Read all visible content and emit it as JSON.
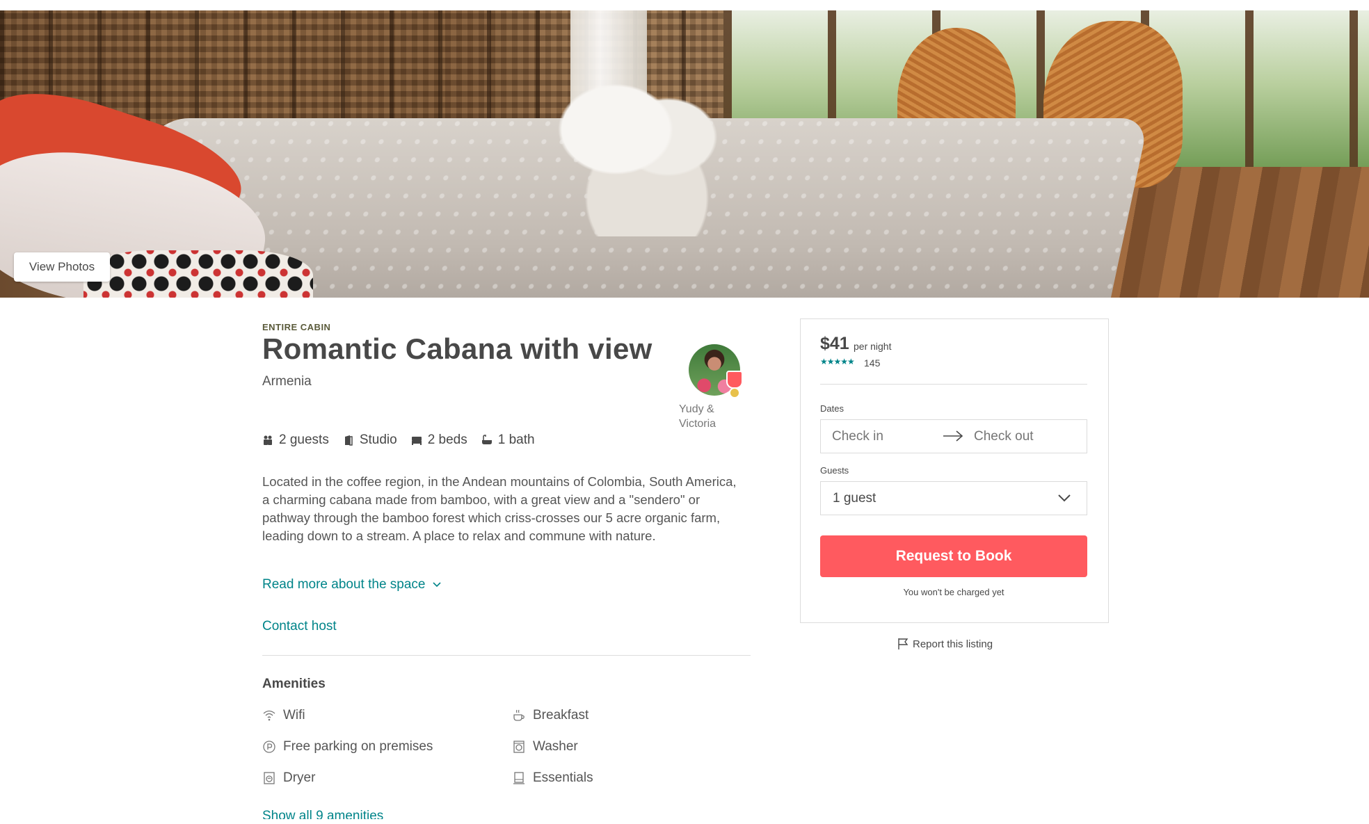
{
  "hero": {
    "view_photos_label": "View Photos"
  },
  "listing": {
    "kind": "ENTIRE CABIN",
    "title": "Romantic Cabana with view",
    "location": "Armenia",
    "host_name": "Yudy & Victoria",
    "facts": {
      "guests": "2 guests",
      "room": "Studio",
      "beds": "2 beds",
      "baths": "1 bath"
    },
    "description": "Located in the coffee region, in the Andean mountains of Colombia, South America, a charming cabana made from bamboo, with a great view and a \"sendero\" or pathway through the bamboo forest which criss-crosses our 5 acre organic farm, leading down to a stream. A place to relax and commune with nature.",
    "read_more_label": "Read more about the space",
    "contact_host_label": "Contact host"
  },
  "amenities": {
    "heading": "Amenities",
    "items": [
      {
        "label": "Wifi",
        "icon": "wifi-icon"
      },
      {
        "label": "Breakfast",
        "icon": "coffee-cup-icon"
      },
      {
        "label": "Free parking on premises",
        "icon": "parking-icon"
      },
      {
        "label": "Washer",
        "icon": "washer-icon"
      },
      {
        "label": "Dryer",
        "icon": "dryer-icon"
      },
      {
        "label": "Essentials",
        "icon": "essentials-icon"
      }
    ],
    "show_all_label": "Show all 9 amenities"
  },
  "booking": {
    "price": "$41",
    "per_night": "per night",
    "stars": "★★★★★",
    "review_count": "145",
    "dates_label": "Dates",
    "check_in_placeholder": "Check in",
    "check_out_placeholder": "Check out",
    "guests_label": "Guests",
    "guests_value": "1 guest",
    "book_button": "Request to Book",
    "charge_note": "You won't be charged yet",
    "report_label": "Report this listing"
  },
  "colors": {
    "accent": "#ff5a5f",
    "link": "#008489",
    "text": "#484848"
  }
}
